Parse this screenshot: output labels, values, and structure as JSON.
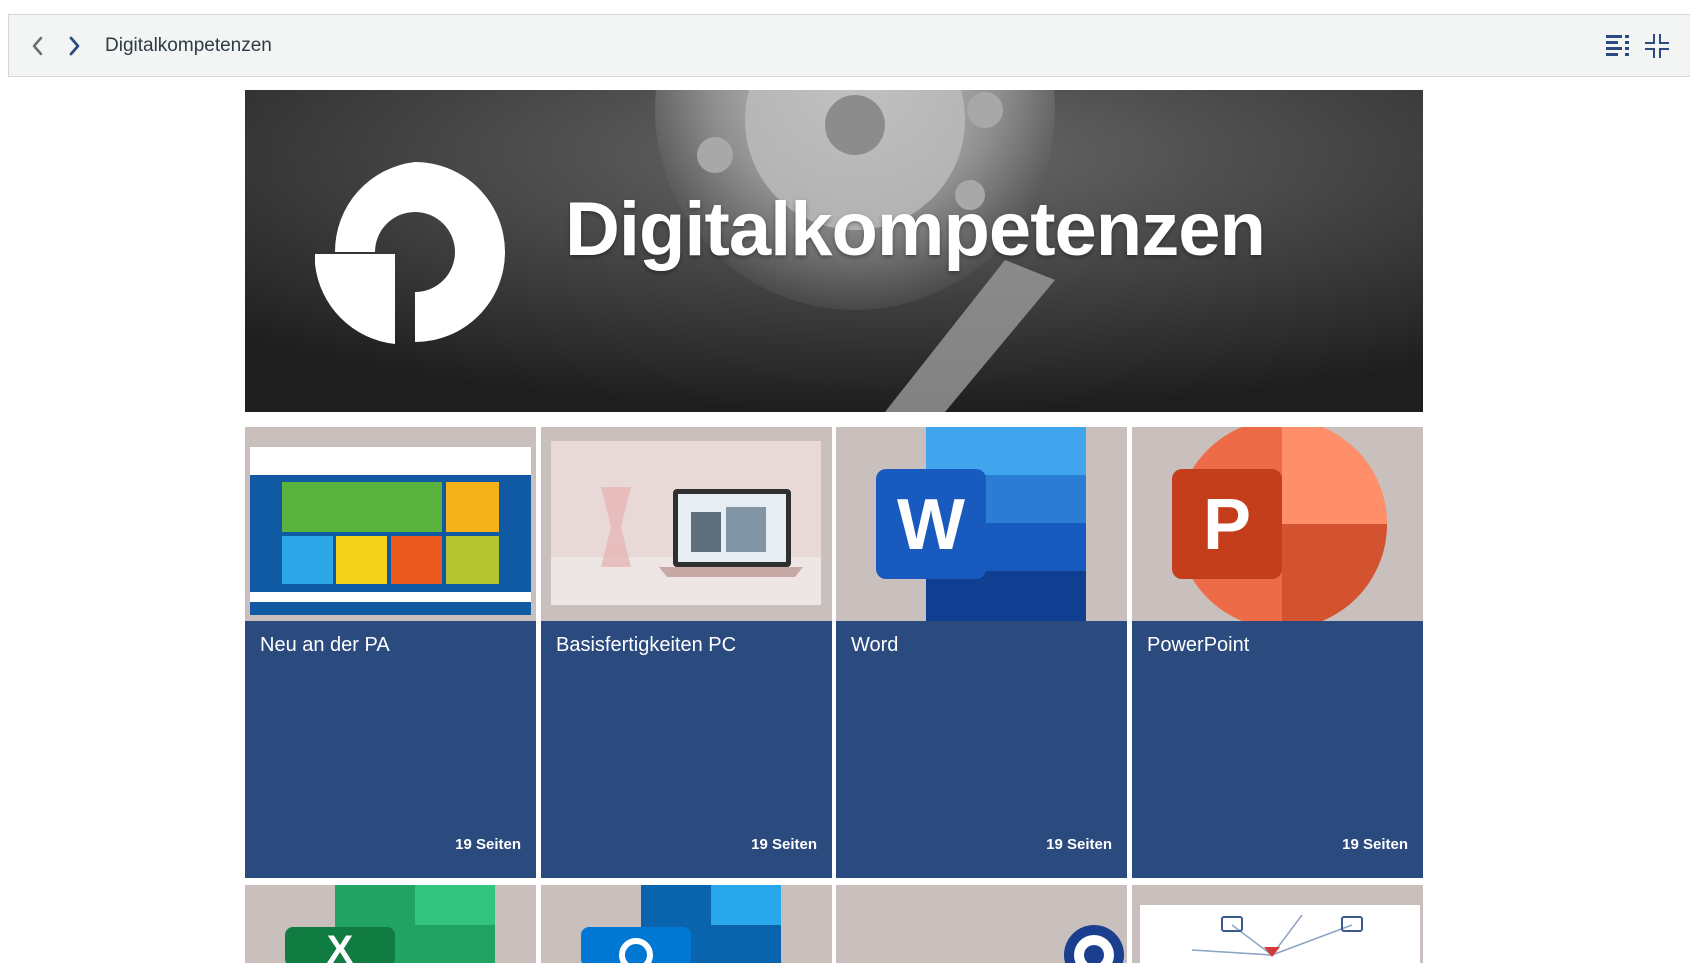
{
  "header": {
    "breadcrumb": "Digitalkompetenzen",
    "icons": {
      "back": "chevron-left-icon",
      "forward": "chevron-right-icon",
      "toc": "table-of-contents-icon",
      "collapse": "collapse-icon"
    },
    "accent": "#2b4a7e"
  },
  "banner": {
    "title": "Digitalkompetenzen"
  },
  "tiles": [
    {
      "label": "Neu an der PA",
      "pages": "19 Seiten"
    },
    {
      "label": "Basisfertigkeiten PC",
      "pages": "19 Seiten"
    },
    {
      "label": "Word",
      "pages": "19 Seiten"
    },
    {
      "label": "PowerPoint",
      "pages": "19 Seiten"
    }
  ],
  "tile_color": "#2b4a7e"
}
